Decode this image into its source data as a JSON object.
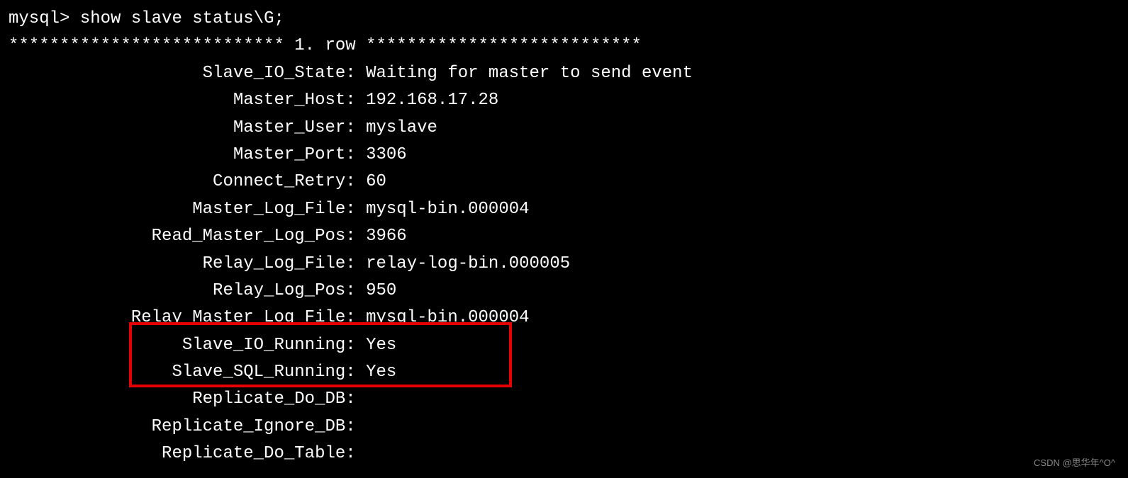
{
  "prompt": "mysql> ",
  "command": "show slave status\\G",
  "command_suffix": ";",
  "row_header": {
    "stars_left": "***************************",
    "label": " 1. row ",
    "stars_right": "***************************"
  },
  "fields": [
    {
      "label": "Slave_IO_State",
      "value": "Waiting for master to send event"
    },
    {
      "label": "Master_Host",
      "value": "192.168.17.28"
    },
    {
      "label": "Master_User",
      "value": "myslave"
    },
    {
      "label": "Master_Port",
      "value": "3306"
    },
    {
      "label": "Connect_Retry",
      "value": "60"
    },
    {
      "label": "Master_Log_File",
      "value": "mysql-bin.000004"
    },
    {
      "label": "Read_Master_Log_Pos",
      "value": "3966"
    },
    {
      "label": "Relay_Log_File",
      "value": "relay-log-bin.000005"
    },
    {
      "label": "Relay_Log_Pos",
      "value": "950"
    },
    {
      "label": "Relay_Master_Log_File",
      "value": "mysql-bin.000004"
    },
    {
      "label": "Slave_IO_Running",
      "value": "Yes"
    },
    {
      "label": "Slave_SQL_Running",
      "value": "Yes"
    },
    {
      "label": "Replicate_Do_DB",
      "value": ""
    },
    {
      "label": "Replicate_Ignore_DB",
      "value": ""
    },
    {
      "label": "Replicate_Do_Table",
      "value": ""
    }
  ],
  "label_width": 33,
  "watermark": "CSDN @思华年^O^"
}
